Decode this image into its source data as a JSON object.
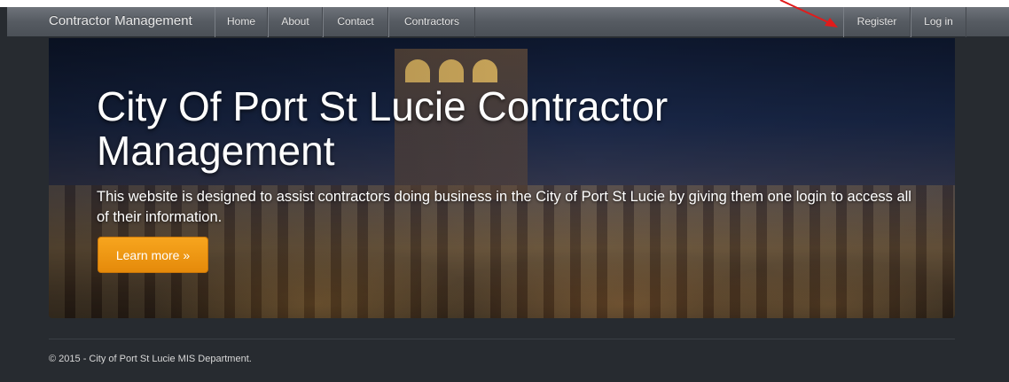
{
  "navbar": {
    "brand": "Contractor Management",
    "items": [
      {
        "label": "Home"
      },
      {
        "label": "About"
      },
      {
        "label": "Contact"
      },
      {
        "label": "Contractors"
      }
    ],
    "right_items": [
      {
        "label": "Register"
      },
      {
        "label": "Log in"
      }
    ]
  },
  "hero": {
    "title": "City Of Port St Lucie Contractor Management",
    "text": "This website is designed to assist contractors doing business in the City of Port St Lucie by giving them one login to access all of their information.",
    "button_label": "Learn more »"
  },
  "footer": {
    "text": "© 2015 - City of Port St Lucie MIS Department."
  },
  "colors": {
    "accent_button": "#f0981a",
    "annotation_arrow": "#e21b1b",
    "page_background": "#272b30"
  }
}
